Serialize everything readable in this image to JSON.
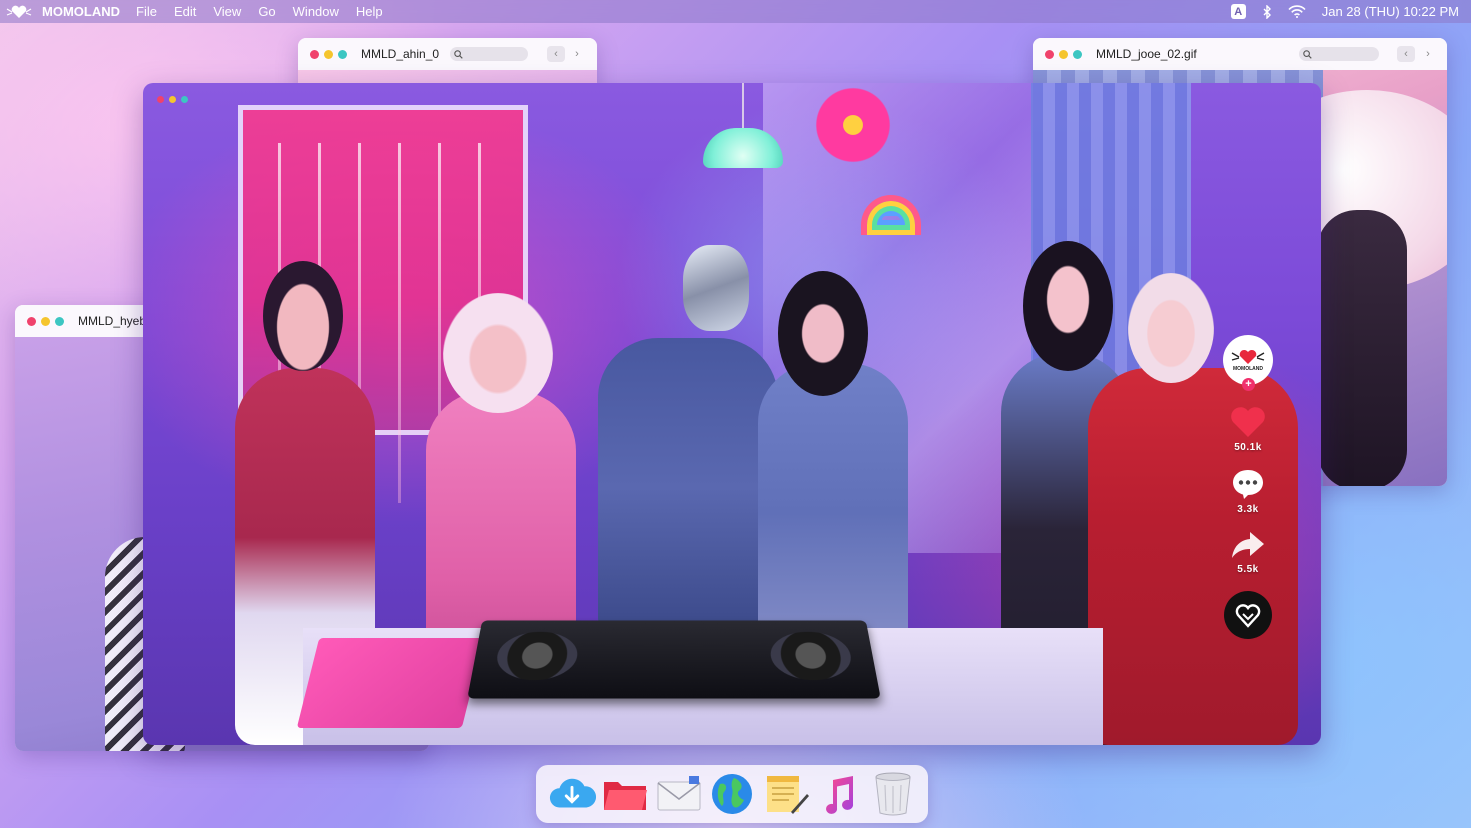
{
  "menubar": {
    "app_name": "MOMOLAND",
    "menus": [
      "File",
      "Edit",
      "View",
      "Go",
      "Window",
      "Help"
    ],
    "input_badge": "A",
    "clock": "Jan 28 (THU)  10:22 PM",
    "icons": [
      "momoland-heart-logo-icon",
      "bluetooth-icon",
      "wifi-icon"
    ]
  },
  "windows": {
    "ahin": {
      "title": "MMLD_ahin_0"
    },
    "jooe": {
      "title": "MMLD_jooe_02.gif"
    },
    "hyebin": {
      "title": "MMLD_hyebi"
    }
  },
  "side_controls": {
    "avatar_label": "MOMOLAND",
    "likes": "50.1k",
    "comments": "3.3k",
    "shares": "5.5k"
  },
  "dock": {
    "items": [
      "cloud-download-icon",
      "folder-icon",
      "mail-icon",
      "globe-icon",
      "notes-icon",
      "music-icon",
      "trash-icon"
    ]
  },
  "colors": {
    "traffic_red": "#f0426c",
    "traffic_yellow": "#f5c52e",
    "traffic_teal": "#3cc6c2",
    "like_red": "#f0304c"
  }
}
